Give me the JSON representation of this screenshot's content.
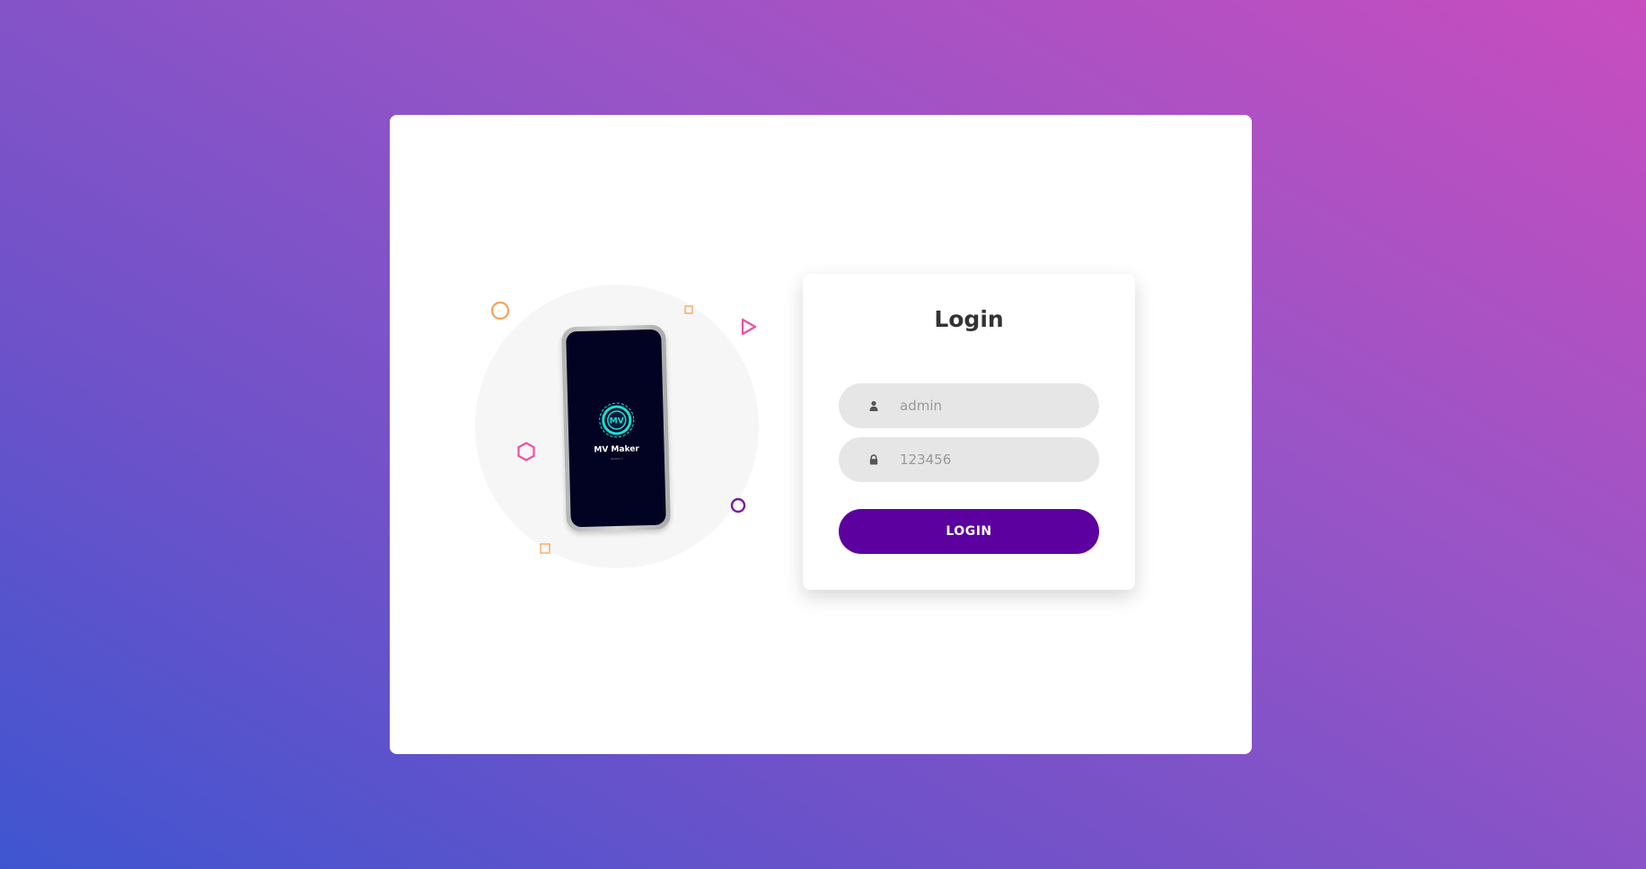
{
  "illustration": {
    "app_name": "MV Maker",
    "app_subtitle": "Version 1",
    "logo_text": "MV"
  },
  "login": {
    "title": "Login",
    "username_placeholder": "admin",
    "password_placeholder": "123456",
    "submit_label": "LOGIN",
    "user_icon": "user-icon",
    "lock_icon": "lock-icon"
  },
  "colors": {
    "button": "#5c00a0",
    "field_bg": "#e6e6e6",
    "gradient_start": "#3f55d0",
    "gradient_end": "#c84dbf",
    "logo_accent": "#19e0d6"
  }
}
